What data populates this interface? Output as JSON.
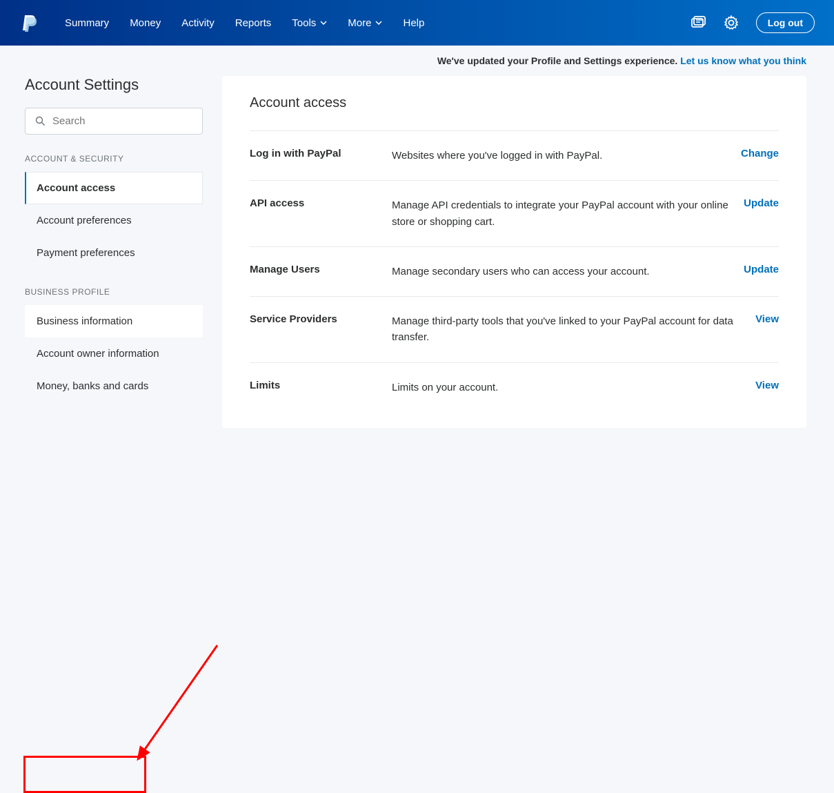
{
  "header": {
    "nav": [
      "Summary",
      "Money",
      "Activity",
      "Reports",
      "Tools",
      "More",
      "Help"
    ],
    "logout": "Log out"
  },
  "notice": {
    "text": "We've updated your Profile and Settings experience. ",
    "link": "Let us know what you think"
  },
  "sidebar": {
    "title": "Account Settings",
    "search_placeholder": "Search",
    "section1_label": "ACCOUNT & SECURITY",
    "section1_items": [
      "Account access",
      "Account preferences",
      "Payment preferences"
    ],
    "section2_label": "BUSINESS PROFILE",
    "section2_items": [
      "Business information",
      "Account owner information",
      "Money, banks and cards"
    ]
  },
  "main": {
    "title": "Account access",
    "rows": [
      {
        "label": "Log in with PayPal",
        "desc": "Websites where you've logged in with PayPal.",
        "action": "Change"
      },
      {
        "label": "API access",
        "desc": "Manage API credentials to integrate your PayPal account with your online store or shopping cart.",
        "action": "Update"
      },
      {
        "label": "Manage Users",
        "desc": "Manage secondary users who can access your account.",
        "action": "Update"
      },
      {
        "label": "Service Providers",
        "desc": "Manage third-party tools that you've linked to your PayPal account for data transfer.",
        "action": "View"
      },
      {
        "label": "Limits",
        "desc": "Limits on your account.",
        "action": "View"
      }
    ]
  }
}
